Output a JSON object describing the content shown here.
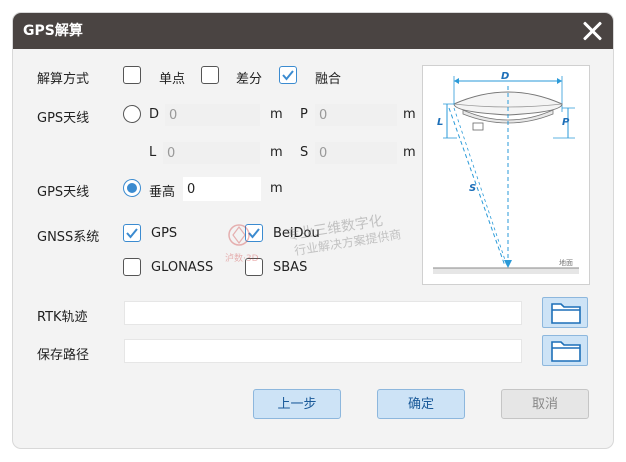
{
  "window": {
    "title": "GPS解算"
  },
  "calc_method": {
    "label": "解算方式",
    "options": [
      {
        "label": "单点",
        "checked": false
      },
      {
        "label": "差分",
        "checked": false
      },
      {
        "label": "融合",
        "checked": true
      }
    ]
  },
  "gps_antenna_1": {
    "label": "GPS天线",
    "radio_label": "D",
    "selected": false,
    "fields": {
      "D": {
        "label": "D",
        "value": "0",
        "unit": "m"
      },
      "P": {
        "label": "P",
        "value": "0",
        "unit": "m"
      },
      "L": {
        "label": "L",
        "value": "0",
        "unit": "m"
      },
      "S": {
        "label": "S",
        "value": "0",
        "unit": "m"
      }
    }
  },
  "gps_antenna_2": {
    "label": "GPS天线",
    "radio_label": "垂高",
    "selected": true,
    "value": "0",
    "unit": "m"
  },
  "gnss": {
    "label": "GNSS系统",
    "options": [
      {
        "label": "GPS",
        "checked": true
      },
      {
        "label": "BeiDou",
        "checked": true
      },
      {
        "label": "GLONASS",
        "checked": false
      },
      {
        "label": "SBAS",
        "checked": false
      }
    ]
  },
  "rtk_track": {
    "label": "RTK轨迹",
    "value": ""
  },
  "save_path": {
    "label": "保存路径",
    "value": ""
  },
  "buttons": {
    "prev": "上一步",
    "ok": "确定",
    "cancel": "取消"
  },
  "diagram": {
    "labels": {
      "D": "D",
      "L": "L",
      "P": "P",
      "S": "S",
      "ground": "地面"
    }
  },
  "watermark": {
    "line1": "专业三维数字化",
    "line2": "行业解决方案提供商",
    "brand": "泸数·3D"
  },
  "colors": {
    "titlebar": "#4a4442",
    "accent": "#3b8bd0",
    "button_fill": "#cde3f6",
    "diagram_line": "#2a9ad8"
  }
}
